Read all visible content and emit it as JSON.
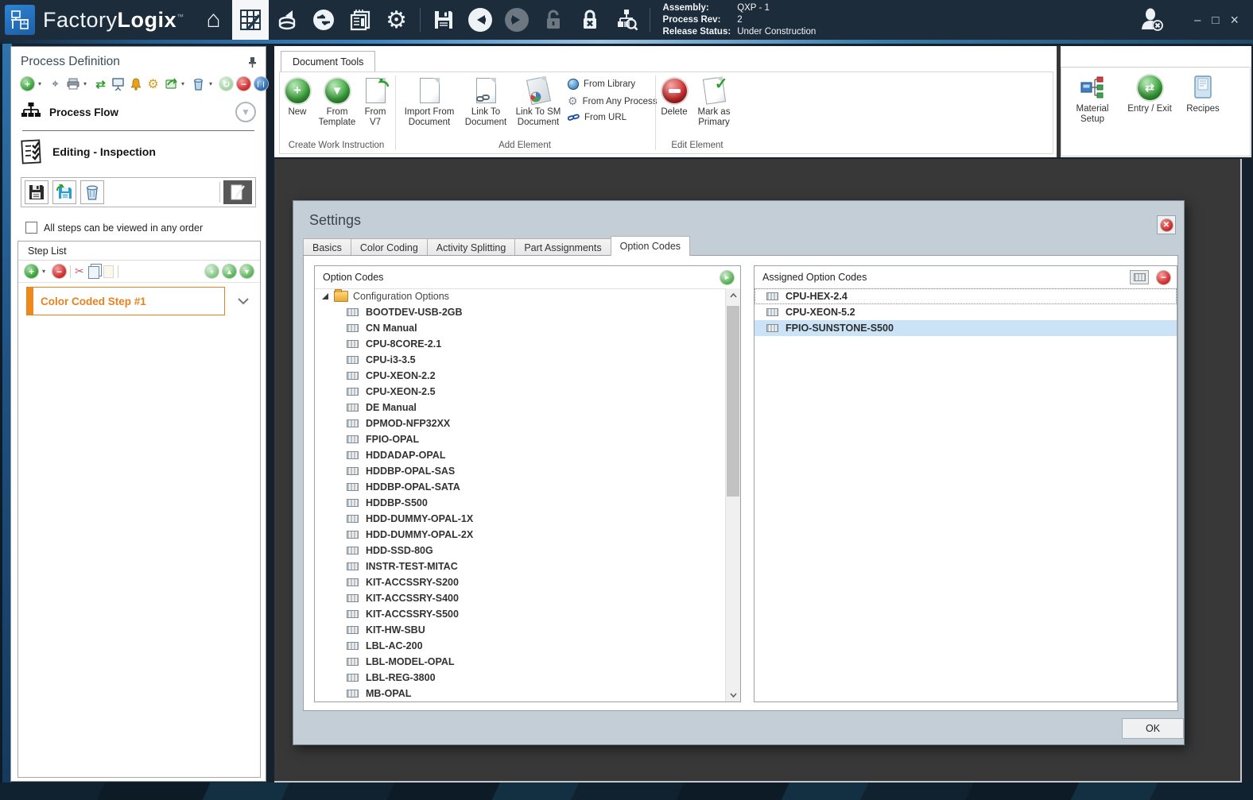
{
  "titlebar": {
    "brand_light": "Factory",
    "brand_bold": "Logix",
    "brand_tm": "™",
    "status": {
      "assembly_label": "Assembly:",
      "assembly_value": "QXP - 1",
      "process_rev_label": "Process Rev:",
      "process_rev_value": "2",
      "release_status_label": "Release Status:",
      "release_status_value": "Under Construction"
    }
  },
  "icons": {
    "home": "⌂",
    "gear": "⚙",
    "sync": "⇄",
    "back": "◄",
    "forward": "►",
    "minimize": "–",
    "maximize": "□",
    "close": "×",
    "plus": "+",
    "minus": "−",
    "caret_down": "▾",
    "up": "▲",
    "down": "▼",
    "right_small": "►",
    "check": "✓",
    "scissors": "✂",
    "pause": "❘❘",
    "recycle": "↻",
    "shuffle": "⇄",
    "binoculars": "⌖",
    "x": "✕"
  },
  "left_panel": {
    "title": "Process Definition",
    "process_flow_label": "Process Flow",
    "editing_label": "Editing - Inspection",
    "checkbox_label": "All steps can be viewed in any order",
    "step_list_title": "Step List",
    "step_label": "Color Coded Step #1"
  },
  "ribbon": {
    "tab": "Document Tools",
    "groups": {
      "create": "Create Work Instruction",
      "add": "Add Element",
      "edit": "Edit Element"
    },
    "buttons": {
      "new": "New",
      "from_template": "From Template",
      "from_v7": "From V7",
      "import_from_document": "Import From Document",
      "link_to_document": "Link To Document",
      "link_to_sm_document": "Link To SM Document",
      "from_library": "From Library",
      "from_any_process": "From Any Process",
      "from_url": "From URL",
      "delete": "Delete",
      "mark_as_primary": "Mark as Primary",
      "material_setup": "Material Setup",
      "entry_exit": "Entry / Exit",
      "recipes": "Recipes"
    }
  },
  "dialog": {
    "title": "Settings",
    "tabs": [
      {
        "label": "Basics",
        "active": false
      },
      {
        "label": "Color Coding",
        "active": false
      },
      {
        "label": "Activity Splitting",
        "active": false
      },
      {
        "label": "Part Assignments",
        "active": false
      },
      {
        "label": "Option Codes",
        "active": true
      }
    ],
    "options_panel": {
      "title": "Option Codes",
      "root": "Configuration Options",
      "items": [
        "BOOTDEV-USB-2GB",
        "CN Manual",
        "CPU-8CORE-2.1",
        "CPU-i3-3.5",
        "CPU-XEON-2.2",
        "CPU-XEON-2.5",
        "DE Manual",
        "DPMOD-NFP32XX",
        "FPIO-OPAL",
        "HDDADAP-OPAL",
        "HDDBP-OPAL-SAS",
        "HDDBP-OPAL-SATA",
        "HDDBP-S500",
        "HDD-DUMMY-OPAL-1X",
        "HDD-DUMMY-OPAL-2X",
        "HDD-SSD-80G",
        "INSTR-TEST-MITAC",
        "KIT-ACCSSRY-S200",
        "KIT-ACCSSRY-S400",
        "KIT-ACCSSRY-S500",
        "KIT-HW-SBU",
        "LBL-AC-200",
        "LBL-MODEL-OPAL",
        "LBL-REG-3800",
        "MB-OPAL"
      ]
    },
    "assigned_panel": {
      "title": "Assigned Option Codes",
      "items": [
        {
          "label": "CPU-HEX-2.4",
          "focused": true,
          "selected": false
        },
        {
          "label": "CPU-XEON-5.2",
          "focused": false,
          "selected": false
        },
        {
          "label": "FPIO-SUNSTONE-S500",
          "focused": false,
          "selected": true
        }
      ]
    },
    "ok_label": "OK"
  },
  "colors": {
    "accent_orange": "#ee8a1d",
    "titlebar_navy": "#1d2c3b",
    "dialog_bg": "#c3ced6",
    "selection_blue": "#cbe3f6",
    "sphere_green": "#3aa33a",
    "sphere_red": "#cf2d2d"
  }
}
